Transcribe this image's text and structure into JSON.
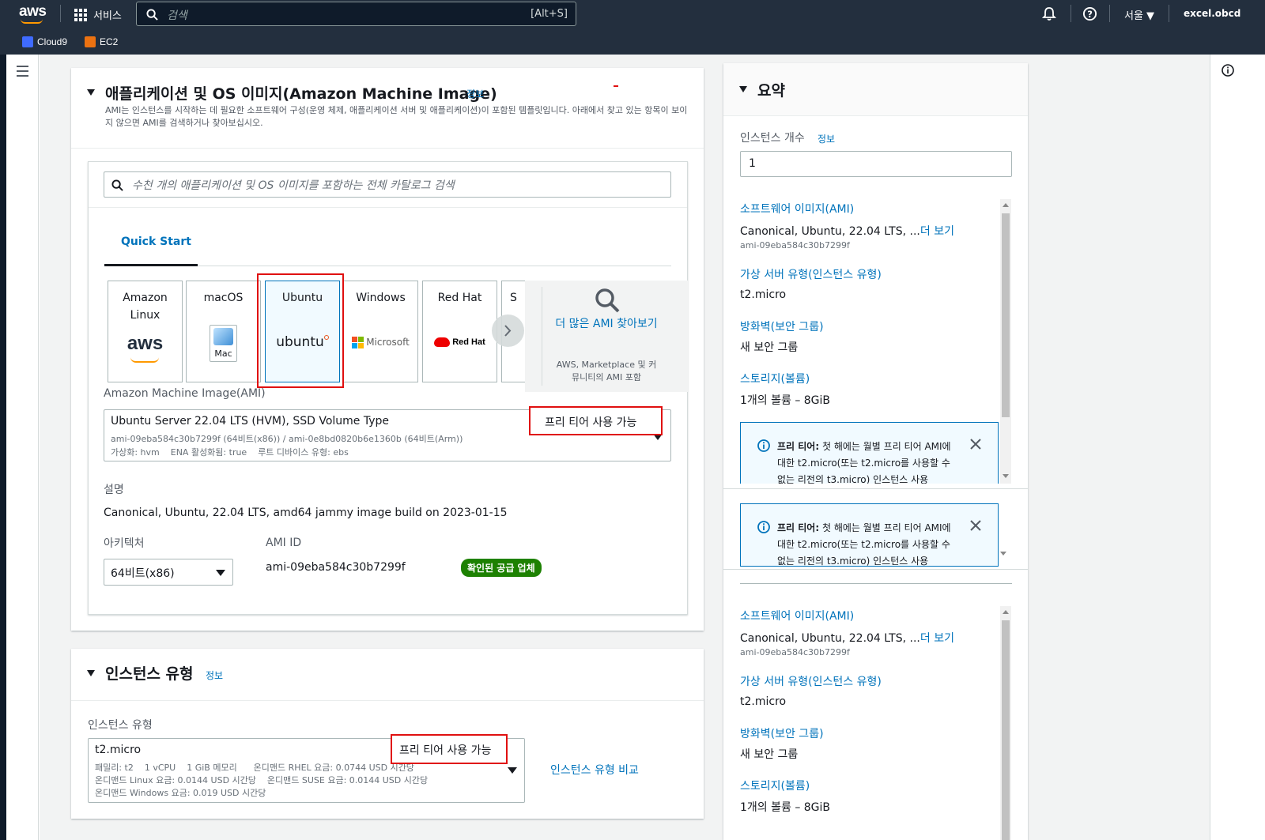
{
  "nav": {
    "logo": "aws",
    "services": "서비스",
    "search_placeholder": "검색",
    "search_shortcut": "[Alt+S]",
    "region": "서울 ▼",
    "account": "excel.obcd",
    "favorites": [
      {
        "label": "Cloud9",
        "color": "#3f6bff"
      },
      {
        "label": "EC2",
        "color": "#ec7211"
      }
    ]
  },
  "ami": {
    "title": "애플리케이션 및 OS 이미지(Amazon Machine Image)",
    "info": "정보",
    "description": "AMI는 인스턴스를 시작하는 데 필요한 소프트웨어 구성(운영 체제, 애플리케이션 서버 및 애플리케이션)이 포함된 템플릿입니다. 아래에서 찾고 있는 항목이 보이지 않으면 AMI를 검색하거나 찾아보십시오.",
    "search_placeholder": "수천 개의 애플리케이션 및 OS 이미지를 포함하는 전체 카탈로그 검색",
    "tab": "Quick Start",
    "tiles": [
      {
        "name": "Amazon Linux",
        "logo": "aws"
      },
      {
        "name": "macOS",
        "logo": "Mac"
      },
      {
        "name": "Ubuntu",
        "logo": "ubuntu"
      },
      {
        "name": "Windows",
        "logo": "Microsoft"
      },
      {
        "name": "Red Hat",
        "logo": "Red Hat"
      },
      {
        "name": "S",
        "logo": ""
      }
    ],
    "browse_more": "더 많은 AMI 찾아보기",
    "browse_more_sub": "AWS, Marketplace 및 커뮤니티의 AMI 포함",
    "ami_label": "Amazon Machine Image(AMI)",
    "selected_name": "Ubuntu Server 22.04 LTS (HVM), SSD Volume Type",
    "selected_ids": "ami-09eba584c30b7299f (64비트(x86)) / ami-0e8bd0820b6e1360b (64비트(Arm))",
    "selected_meta": "가상화: hvm    ENA 활성화됨: true    루트 디바이스 유형: ebs",
    "free_tier": "프리 티어 사용 가능",
    "desc_label": "설명",
    "desc_value": "Canonical, Ubuntu, 22.04 LTS, amd64 jammy image build on 2023-01-15",
    "arch_label": "아키텍처",
    "arch_value": "64비트(x86)",
    "ami_id_label": "AMI ID",
    "ami_id_value": "ami-09eba584c30b7299f",
    "verified": "확인된 공급 업체"
  },
  "instance": {
    "title": "인스턴스 유형",
    "info": "정보",
    "label": "인스턴스 유형",
    "type": "t2.micro",
    "line1": "패밀리: t2    1 vCPU    1 GiB 메모리      온디맨드 RHEL 요금: 0.0744 USD 시간당",
    "line2": "온디맨드 Linux 요금: 0.0144 USD 시간당    온디맨드 SUSE 요금: 0.0144 USD 시간당",
    "line3": "온디맨드 Windows 요금: 0.019 USD 시간당",
    "free_tier": "프리 티어 사용 가능",
    "compare": "인스턴스 유형 비교"
  },
  "summary": {
    "title": "요약",
    "count_label": "인스턴스 개수",
    "count_info": "정보",
    "count_value": "1",
    "ami_label": "소프트웨어 이미지(AMI)",
    "ami_value": "Canonical, Ubuntu, 22.04 LTS, ...",
    "more": "더 보기",
    "ami_id": "ami-09eba584c30b7299f",
    "type_label": "가상 서버 유형(인스턴스 유형)",
    "type_value": "t2.micro",
    "fw_label": "방화벽(보안 그룹)",
    "fw_value": "새 보안 그룹",
    "storage_label": "스토리지(볼륨)",
    "storage_value": "1개의 볼륨 – 8GiB",
    "alert_title": "프리 티어:",
    "alert_text": "첫 해에는 월별 프리 티어 AMI에 대한 t2.micro(또는 t2.micro를 사용할 수 없는 리전의 t3.micro) 인스턴스 사용"
  }
}
